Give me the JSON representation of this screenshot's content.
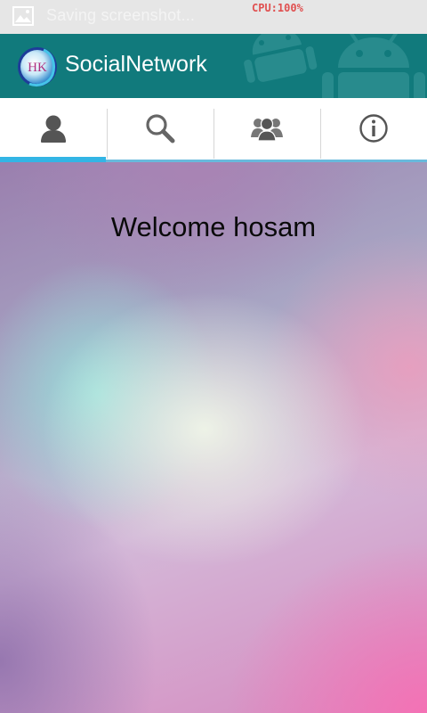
{
  "status_bar": {
    "icon": "image-icon",
    "notification_text": "Saving screenshot...",
    "cpu_text": "CPU:100%"
  },
  "action_bar": {
    "logo": "hk-logo",
    "logo_text": "HK",
    "title": "SocialNetwork",
    "color": "#117a7c"
  },
  "tabs": [
    {
      "icon": "person-icon",
      "selected": true
    },
    {
      "icon": "search-icon",
      "selected": false
    },
    {
      "icon": "group-icon",
      "selected": false
    },
    {
      "icon": "info-icon",
      "selected": false
    }
  ],
  "accent_color": "#33b5e5",
  "content": {
    "welcome_text": "Welcome hosam"
  }
}
